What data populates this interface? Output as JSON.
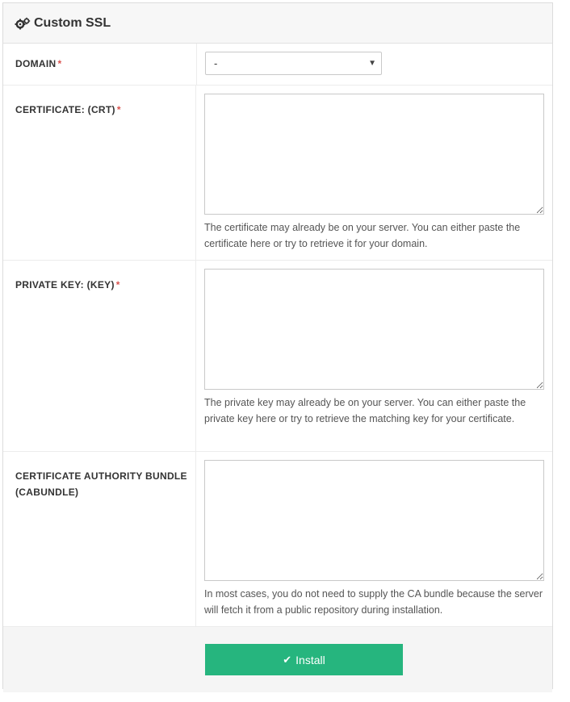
{
  "header": {
    "title": "Custom SSL",
    "icon": "gears-icon"
  },
  "fields": {
    "domain": {
      "label": "DOMAIN",
      "required": "*",
      "selected": "-"
    },
    "certificate": {
      "label": "CERTIFICATE: (CRT)",
      "required": "*",
      "value": "",
      "help": "The certificate may already be on your server. You can either paste the certificate here or try to retrieve it for your domain."
    },
    "private_key": {
      "label": "PRIVATE KEY: (KEY)",
      "required": "*",
      "value": "",
      "help": "The private key may already be on your server. You can either paste the private key here or try to retrieve the matching key for your certificate."
    },
    "cabundle": {
      "label": "CERTIFICATE AUTHORITY BUNDLE (CABUNDLE)",
      "value": "",
      "help": "In most cases, you do not need to supply the CA bundle because the server will fetch it from a public repository during installation."
    }
  },
  "footer": {
    "install_label": "Install"
  },
  "colors": {
    "accent": "#26b57e",
    "required": "#d9534f"
  }
}
